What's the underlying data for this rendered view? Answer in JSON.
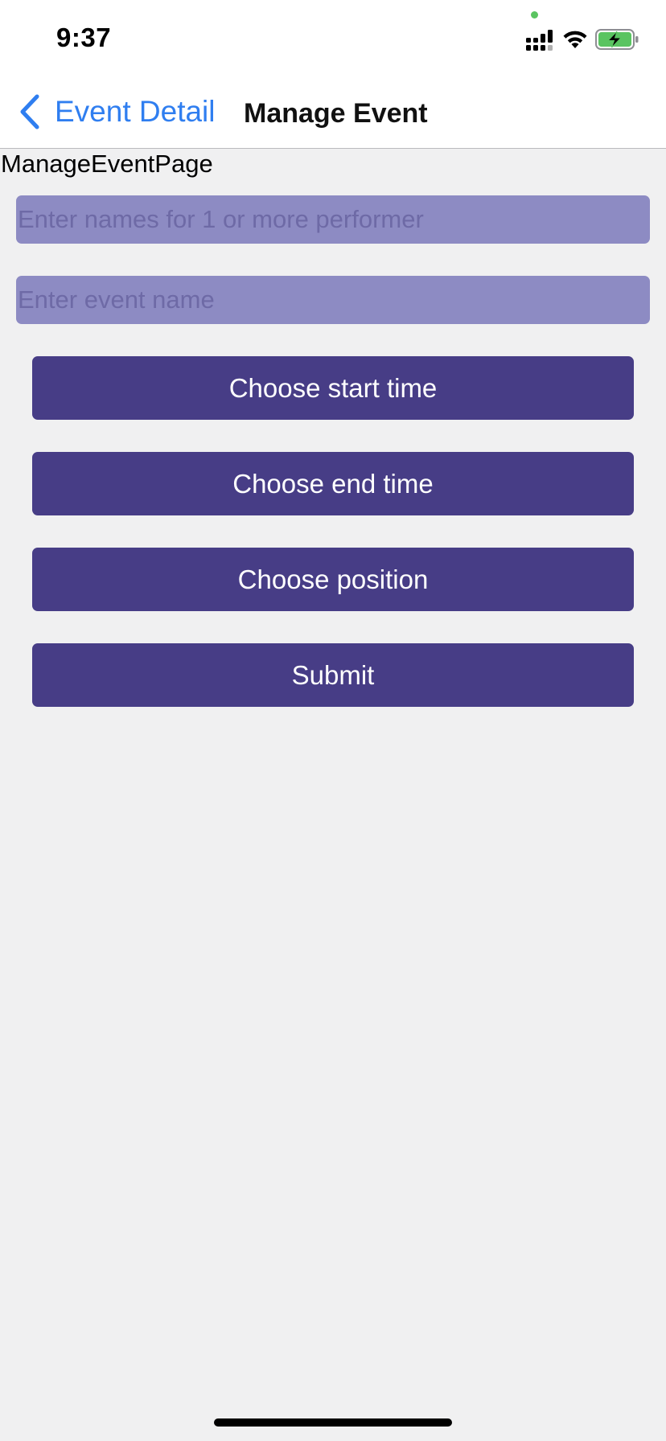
{
  "status_bar": {
    "time": "9:37",
    "icons": [
      "cellular-signal-icon",
      "wifi-icon",
      "battery-charging-icon"
    ],
    "mic_indicator_color": "#5ac461",
    "battery_fill_color": "#5ac461"
  },
  "nav": {
    "back_label": "Event Detail",
    "title": "Manage Event",
    "tint_color": "#2f7ef0"
  },
  "page": {
    "label": "ManageEventPage"
  },
  "form": {
    "performers_placeholder": "Enter names for 1 or more performer",
    "performers_value": "",
    "event_name_placeholder": "Enter event name",
    "event_name_value": "",
    "field_color": "#8d8bc3"
  },
  "buttons": {
    "start_time": "Choose start time",
    "end_time": "Choose end time",
    "position": "Choose position",
    "submit": "Submit",
    "color": "#473d86"
  }
}
